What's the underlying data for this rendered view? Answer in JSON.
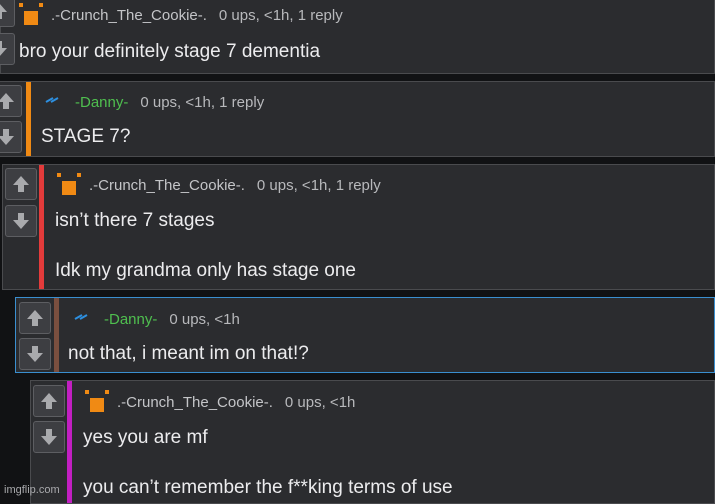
{
  "comments": [
    {
      "user": ".-Crunch_The_Cookie-.",
      "meta": "0 ups, <1h, 1 reply",
      "lines": [
        "bro your definitely stage 7 dementia"
      ],
      "bar_color": "",
      "avatar": "cookie-avatar-icon"
    },
    {
      "user": "-Danny-",
      "meta": "0 ups, <1h, 1 reply",
      "lines": [
        "STAGE 7?"
      ],
      "bar_color": "#f08a14",
      "avatar": "danny-avatar-icon"
    },
    {
      "user": ".-Crunch_The_Cookie-.",
      "meta": "0 ups, <1h, 1 reply",
      "lines": [
        "isn’t there 7 stages",
        "Idk my grandma only has stage one"
      ],
      "bar_color": "#e33b3b",
      "avatar": "cookie-avatar-icon"
    },
    {
      "user": "-Danny-",
      "meta": "0 ups, <1h",
      "lines": [
        "not that, i meant im on that!?"
      ],
      "bar_color": "#7a4f3f",
      "avatar": "danny-avatar-icon"
    },
    {
      "user": ".-Crunch_The_Cookie-.",
      "meta": "0 ups, <1h",
      "lines": [
        "yes you are mf",
        "you can’t remember the f**king terms of use"
      ],
      "bar_color": "#c21fc2",
      "avatar": "cookie-avatar-icon"
    }
  ],
  "watermark": "imgflip.com",
  "colors": {
    "background": "#111214",
    "panel": "#2b2c2f",
    "selected_border": "#3a8fd0",
    "danny_name": "#4fbf4f"
  }
}
